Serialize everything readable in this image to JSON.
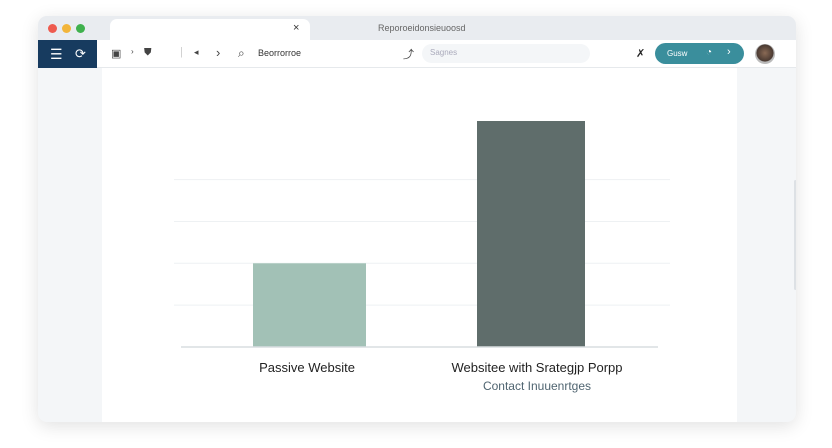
{
  "window": {
    "title": "Reporoeidonsieuoosd",
    "tab_close": "×"
  },
  "toolbar": {
    "breadcrumb": "Beorrorroe",
    "search_placeholder": "Sagnes",
    "pill_label": "Gusw"
  },
  "colors": {
    "nav": "#173b5f",
    "accent": "#3a8e9c",
    "bar1": "#a2c1b6",
    "bar2": "#5f6d6b"
  },
  "chart_data": {
    "type": "bar",
    "categories": [
      "Passive Website",
      "Websitee with Srategjp Porpp"
    ],
    "values": [
      2,
      5.4
    ],
    "subtitle": "Contact Inuuenrtges",
    "title": "",
    "xlabel": "",
    "ylabel": "",
    "ylim": [
      0,
      5.4
    ],
    "grid": true,
    "gridlines": [
      1,
      2,
      3,
      4
    ]
  }
}
